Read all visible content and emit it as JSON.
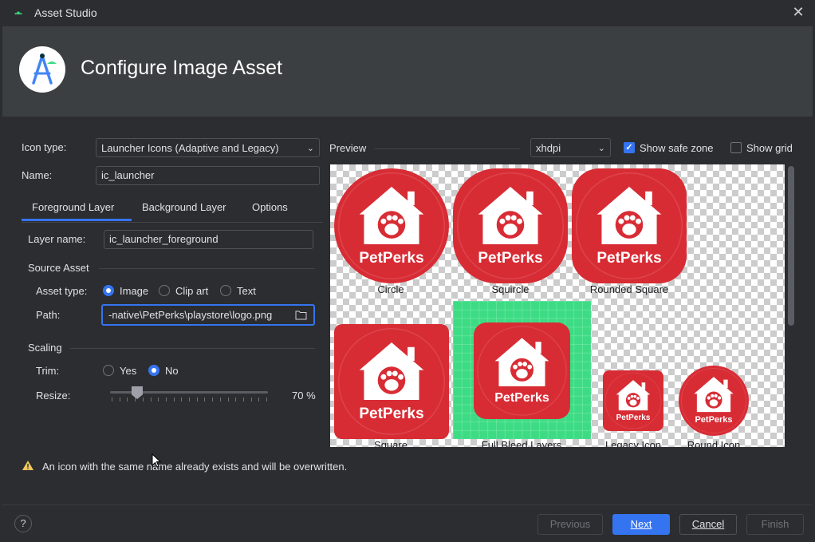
{
  "window": {
    "title": "Asset Studio"
  },
  "header": {
    "title": "Configure Image Asset"
  },
  "form": {
    "icon_type_label": "Icon type:",
    "icon_type_value": "Launcher Icons (Adaptive and Legacy)",
    "name_label": "Name:",
    "name_value": "ic_launcher"
  },
  "tabs": [
    {
      "label": "Foreground Layer",
      "selected": true
    },
    {
      "label": "Background Layer",
      "selected": false
    },
    {
      "label": "Options",
      "selected": false
    }
  ],
  "foreground": {
    "layer_name_label": "Layer name:",
    "layer_name_value": "ic_launcher_foreground",
    "source_asset_title": "Source Asset",
    "asset_type_label": "Asset type:",
    "asset_type_options": [
      "Image",
      "Clip art",
      "Text"
    ],
    "asset_type_selected": "Image",
    "path_label": "Path:",
    "path_value": "-native\\PetPerks\\playstore\\logo.png",
    "scaling_title": "Scaling",
    "trim_label": "Trim:",
    "trim_options": [
      "Yes",
      "No"
    ],
    "trim_selected": "No",
    "resize_label": "Resize:",
    "resize_value": "70 %",
    "resize_percent": 70
  },
  "preview": {
    "label": "Preview",
    "density_value": "xhdpi",
    "show_safe_zone_label": "Show safe zone",
    "show_safe_zone_checked": true,
    "show_grid_label": "Show grid",
    "show_grid_checked": false,
    "brand_text": "PetPerks",
    "icons": [
      {
        "caption": "Circle"
      },
      {
        "caption": "Squircle"
      },
      {
        "caption": "Rounded Square"
      },
      {
        "caption": "Square"
      },
      {
        "caption": "Full Bleed Layers"
      },
      {
        "caption": "Legacy Icon"
      },
      {
        "caption": "Round Icon"
      }
    ]
  },
  "warning": {
    "text": "An icon with the same name already exists and will be overwritten."
  },
  "footer": {
    "help_label": "?",
    "previous_label": "Previous",
    "next_label": "Next",
    "cancel_label": "Cancel",
    "finish_label": "Finish"
  },
  "colors": {
    "accent": "#3574f0",
    "icon_red": "#d82c35",
    "full_bleed_green": "#3ddc84",
    "warning": "#f2c55c"
  }
}
